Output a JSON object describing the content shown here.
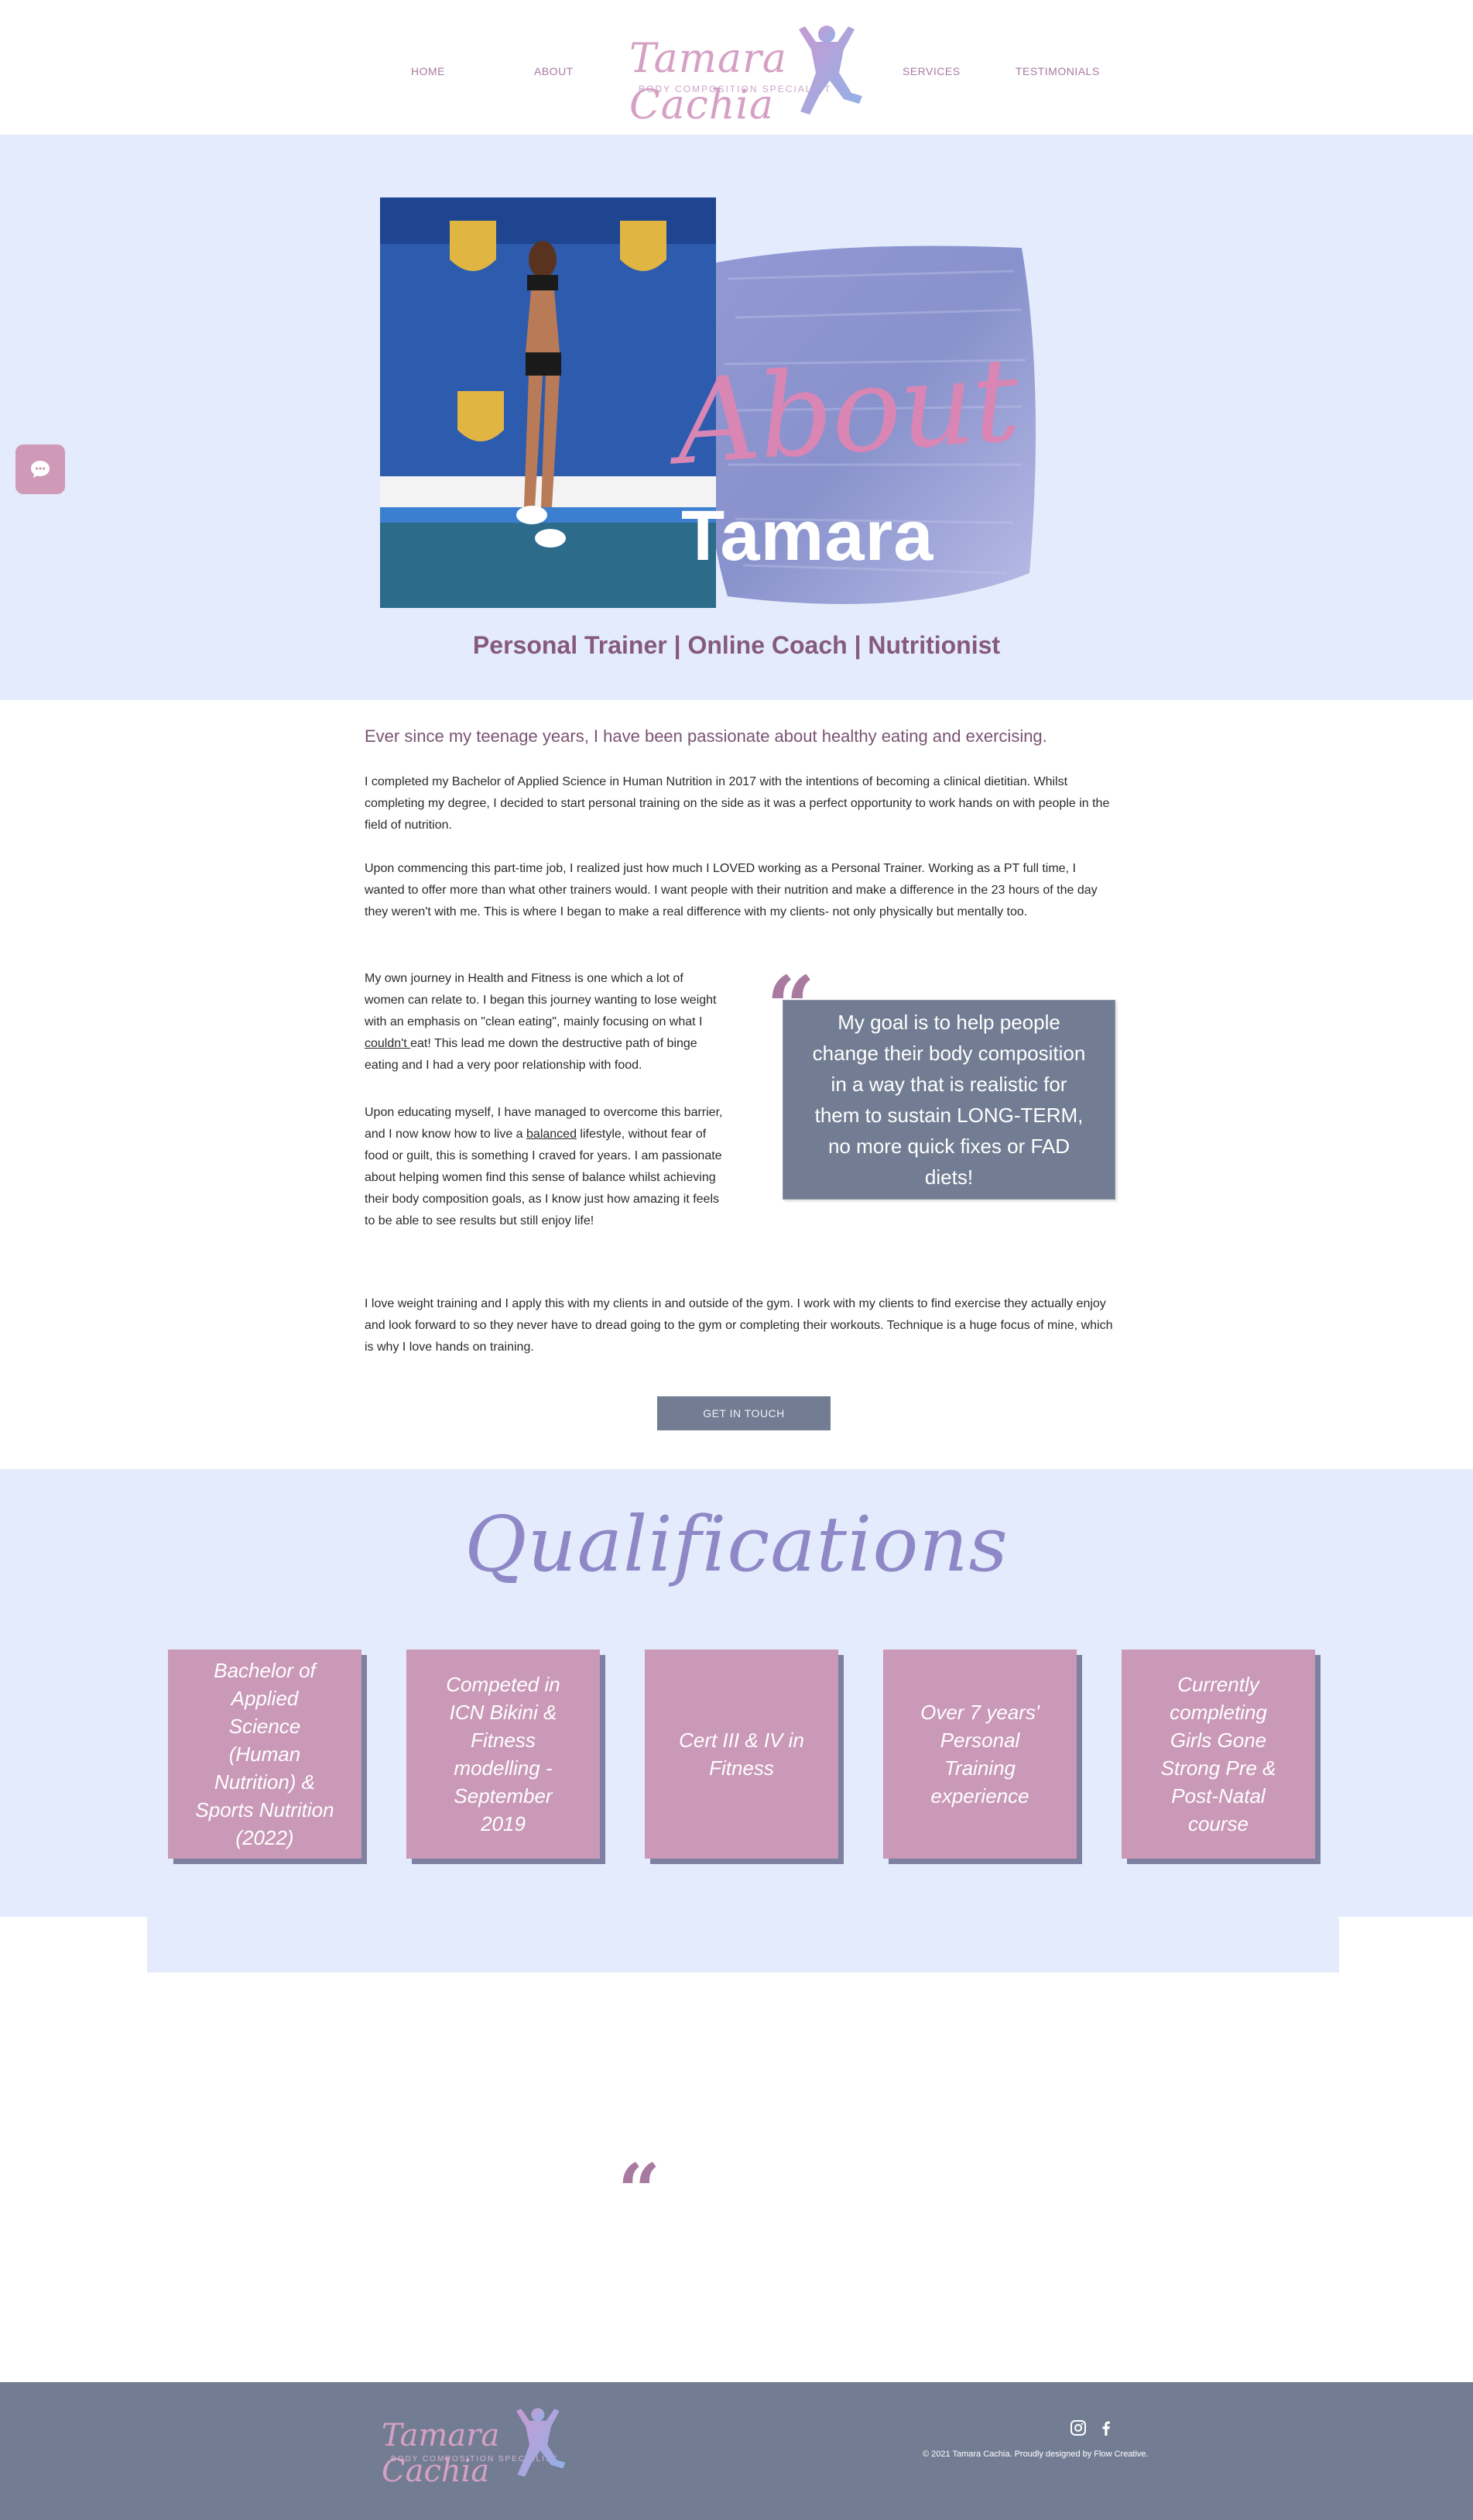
{
  "nav": {
    "home": "HOME",
    "about": "ABOUT",
    "services": "SERVICES",
    "testimonials": "TESTIMONIALS"
  },
  "logo": {
    "script": "Tamara Cachia",
    "tagline": "BODY COMPOSITION SPECIALIST"
  },
  "hero": {
    "script_title": "About",
    "name": "Tamara",
    "subtitle": "Personal Trainer | Online Coach | Nutritionist"
  },
  "content": {
    "lead": "Ever since my teenage years, I have been passionate about healthy eating and exercising.",
    "p1": "I completed my Bachelor of Applied Science in Human Nutrition in 2017 with the intentions of becoming a clinical dietitian. Whilst completing my degree, I decided to start personal training on the side as it was a perfect opportunity to work hands on with people in the field of nutrition.",
    "p2": "Upon commencing this part-time job, I realized just how much I LOVED working as a Personal Trainer. Working as a PT full time, I wanted to offer more than what other trainers would. I want people with their nutrition and make a difference in the 23 hours of the day they weren't with me. This is where I began to make a real difference with my clients- not only physically but mentally too.",
    "p3_a": "My own journey in Health and Fitness is one which a lot of women can relate to. I began this journey wanting to lose weight with an emphasis on \"clean eating\", mainly focusing on what I ",
    "p3_u": "couldn't ",
    "p3_b": "eat! This lead me down the destructive path of binge eating and I had a very poor relationship with food.",
    "p4_a": "Upon educating myself, I have managed to overcome this barrier, and I now know how to live a ",
    "p4_u": "balanced",
    "p4_b": " lifestyle, without fear of food or guilt, this is something I craved for years. I am passionate about helping women find this sense of balance whilst achieving their body composition goals, as I know just how amazing it feels to be able to see results but still enjoy life!",
    "quote": "My goal is to help people change their body composition in a way that is realistic for them to sustain LONG-TERM, no more quick fixes or FAD diets!",
    "p5": "I love weight training and I apply this with my clients in and outside of the gym. I work with my clients to find exercise they actually enjoy and look forward to so they never have to dread going to the gym or completing their workouts. Technique is a huge focus of mine, which is why I love hands on training.",
    "cta": "GET IN TOUCH"
  },
  "qualifications": {
    "title": "Qualifications",
    "cards": [
      "Bachelor of Applied Science (Human Nutrition) & Sports Nutrition (2022)",
      "Competed in ICN Bikini & Fitness modelling - September 2019",
      "Cert III & IV in Fitness",
      "Over 7 years' Personal Training experience",
      "Currently completing Girls Gone Strong Pre & Post-Natal course"
    ]
  },
  "footer": {
    "copyright": "© 2021 Tamara Cachia.  Proudly designed by Flow Creative."
  },
  "colors": {
    "hero_bg": "#e3ebfc",
    "accent_mauve": "#a87aa0",
    "slate": "#727d93",
    "card_pink": "#c999b7",
    "script_lilac": "#8e88c7"
  },
  "icons": [
    "chat-icon",
    "instagram-icon",
    "facebook-icon",
    "quote-icon",
    "fitness-figure-icon"
  ]
}
